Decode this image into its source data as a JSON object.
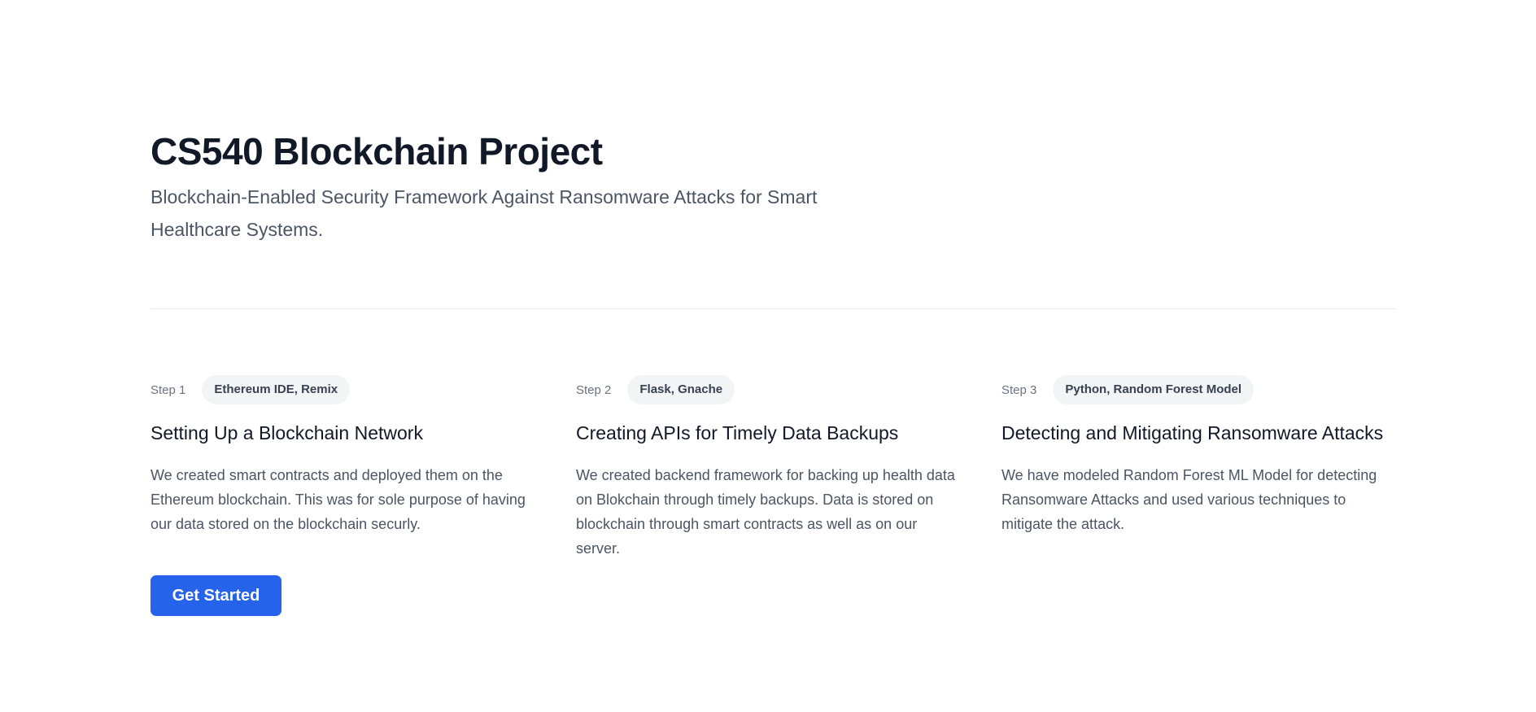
{
  "hero": {
    "title": "CS540 Blockchain Project",
    "subtitle": "Blockchain-Enabled Security Framework Against Ransomware Attacks for Smart Healthcare Systems."
  },
  "steps": [
    {
      "label": "Step 1",
      "tag": "Ethereum IDE, Remix",
      "title": "Setting Up a Blockchain Network",
      "description": "We created smart contracts and deployed them on the Ethereum blockchain. This was for sole purpose of having our data stored on the blockchain securly."
    },
    {
      "label": "Step 2",
      "tag": "Flask, Gnache",
      "title": "Creating APIs for Timely Data Backups",
      "description": "We created backend framework for backing up health data on Blokchain through timely backups. Data is stored on blockchain through smart contracts as well as on our server."
    },
    {
      "label": "Step 3",
      "tag": "Python, Random Forest Model",
      "title": "Detecting and Mitigating Ransomware Attacks",
      "description": "We have modeled Random Forest ML Model for detecting Ransomware Attacks and used various techniques to mitigate the attack."
    }
  ],
  "cta": {
    "label": "Get Started"
  },
  "colors": {
    "accent": "#2563eb",
    "heading": "#111827",
    "body": "#4b5563",
    "tag_bg": "#f3f4f6",
    "divider": "#e5e7eb"
  }
}
